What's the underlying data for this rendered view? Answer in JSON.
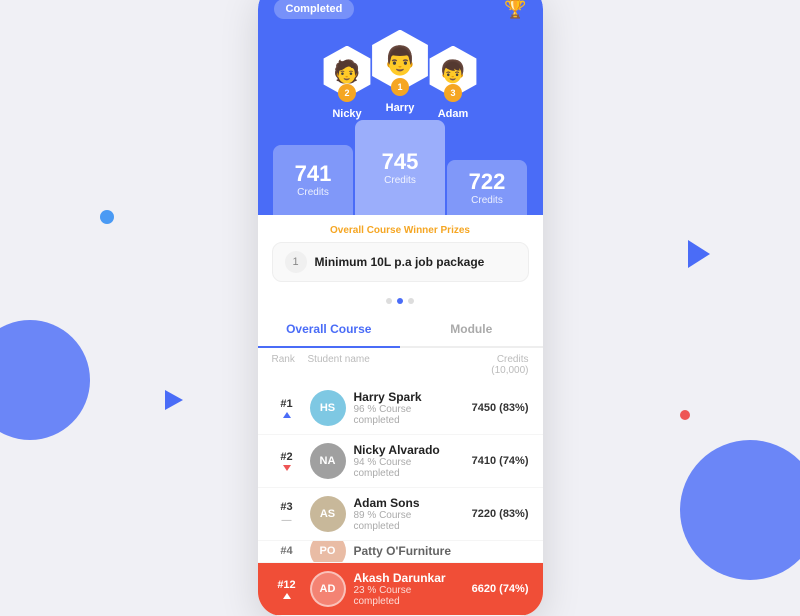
{
  "background": {
    "color": "#f0f0f5"
  },
  "card": {
    "completed_badge": "Completed",
    "trophy_icon": "🏆",
    "podium": {
      "first": {
        "name": "Harry",
        "rank": "1",
        "credits": "745",
        "credits_label": "Credits",
        "avatar_emoji": "👨"
      },
      "second": {
        "name": "Nicky",
        "rank": "2",
        "credits": "741",
        "credits_label": "Credits",
        "avatar_emoji": "🧑"
      },
      "third": {
        "name": "Adam",
        "rank": "3",
        "credits": "722",
        "credits_label": "Credits",
        "avatar_emoji": "👦"
      }
    },
    "prize": {
      "title": "Overall Course Winner Prizes",
      "items": [
        {
          "num": "1",
          "text": "Minimum 10L p.a job package"
        }
      ]
    },
    "dots": [
      false,
      true,
      false
    ],
    "tabs": [
      "Overall Course",
      "Module"
    ],
    "active_tab": 0,
    "table_header": {
      "rank": "Rank",
      "student_name": "Student name",
      "credits": "Credits (10,000)"
    },
    "students": [
      {
        "rank": "#1",
        "arrow": "up",
        "name": "Harry Spark",
        "completion": "96 % Course completed",
        "credits": "7450 (83%)",
        "avatar_color": "#7ec8e3",
        "initials": "HS"
      },
      {
        "rank": "#2",
        "arrow": "down",
        "name": "Nicky Alvarado",
        "completion": "94 % Course completed",
        "credits": "7410 (74%)",
        "avatar_color": "#a0a0a0",
        "initials": "NA"
      },
      {
        "rank": "#3",
        "arrow": "none",
        "name": "Adam Sons",
        "completion": "89 % Course completed",
        "credits": "7220 (83%)",
        "avatar_color": "#c8b89a",
        "initials": "AS"
      },
      {
        "rank": "#4",
        "arrow": "up",
        "name": "Patty O'Furniture",
        "completion": "",
        "credits": "...",
        "avatar_color": "#e0a080",
        "initials": "PO",
        "partial": true
      }
    ],
    "highlighted_student": {
      "rank": "#12",
      "arrow": "up",
      "name": "Akash Darunkar",
      "completion": "23 % Course completed",
      "credits": "6620 (74%)",
      "avatar_color": "#ffffff",
      "initials": "AD"
    }
  }
}
